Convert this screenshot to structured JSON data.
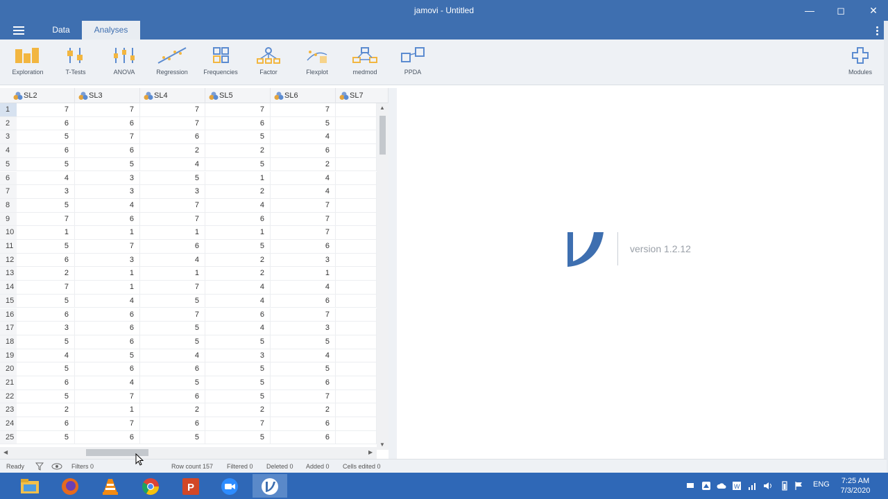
{
  "window": {
    "title": "jamovi - Untitled"
  },
  "tabs": [
    {
      "label": "Data"
    },
    {
      "label": "Analyses"
    }
  ],
  "ribbon": [
    {
      "label": "Exploration",
      "icon": "exploration-icon"
    },
    {
      "label": "T-Tests",
      "icon": "ttests-icon"
    },
    {
      "label": "ANOVA",
      "icon": "anova-icon"
    },
    {
      "label": "Regression",
      "icon": "regression-icon"
    },
    {
      "label": "Frequencies",
      "icon": "frequencies-icon"
    },
    {
      "label": "Factor",
      "icon": "factor-icon"
    },
    {
      "label": "Flexplot",
      "icon": "flexplot-icon"
    },
    {
      "label": "medmod",
      "icon": "medmod-icon"
    },
    {
      "label": "PPDA",
      "icon": "ppda-icon"
    },
    {
      "label": "Modules",
      "icon": "modules-plus-icon"
    }
  ],
  "grid": {
    "columns": [
      "SL2",
      "SL3",
      "SL4",
      "SL5",
      "SL6",
      "SL7"
    ],
    "rows": [
      {
        "n": "1",
        "v": [
          "7",
          "7",
          "7",
          "7",
          "7",
          ""
        ]
      },
      {
        "n": "2",
        "v": [
          "6",
          "6",
          "7",
          "6",
          "5",
          ""
        ]
      },
      {
        "n": "3",
        "v": [
          "5",
          "7",
          "6",
          "5",
          "4",
          ""
        ]
      },
      {
        "n": "4",
        "v": [
          "6",
          "6",
          "2",
          "2",
          "6",
          ""
        ]
      },
      {
        "n": "5",
        "v": [
          "5",
          "5",
          "4",
          "5",
          "2",
          ""
        ]
      },
      {
        "n": "6",
        "v": [
          "4",
          "3",
          "5",
          "1",
          "4",
          ""
        ]
      },
      {
        "n": "7",
        "v": [
          "3",
          "3",
          "3",
          "2",
          "4",
          ""
        ]
      },
      {
        "n": "8",
        "v": [
          "5",
          "4",
          "7",
          "4",
          "7",
          ""
        ]
      },
      {
        "n": "9",
        "v": [
          "7",
          "6",
          "7",
          "6",
          "7",
          ""
        ]
      },
      {
        "n": "10",
        "v": [
          "1",
          "1",
          "1",
          "1",
          "7",
          ""
        ]
      },
      {
        "n": "11",
        "v": [
          "5",
          "7",
          "6",
          "5",
          "6",
          ""
        ]
      },
      {
        "n": "12",
        "v": [
          "6",
          "3",
          "4",
          "2",
          "3",
          ""
        ]
      },
      {
        "n": "13",
        "v": [
          "2",
          "1",
          "1",
          "2",
          "1",
          ""
        ]
      },
      {
        "n": "14",
        "v": [
          "7",
          "1",
          "7",
          "4",
          "4",
          ""
        ]
      },
      {
        "n": "15",
        "v": [
          "5",
          "4",
          "5",
          "4",
          "6",
          ""
        ]
      },
      {
        "n": "16",
        "v": [
          "6",
          "6",
          "7",
          "6",
          "7",
          ""
        ]
      },
      {
        "n": "17",
        "v": [
          "3",
          "6",
          "5",
          "4",
          "3",
          ""
        ]
      },
      {
        "n": "18",
        "v": [
          "5",
          "6",
          "5",
          "5",
          "5",
          ""
        ]
      },
      {
        "n": "19",
        "v": [
          "4",
          "5",
          "4",
          "3",
          "4",
          ""
        ]
      },
      {
        "n": "20",
        "v": [
          "5",
          "6",
          "6",
          "5",
          "5",
          ""
        ]
      },
      {
        "n": "21",
        "v": [
          "6",
          "4",
          "5",
          "5",
          "6",
          ""
        ]
      },
      {
        "n": "22",
        "v": [
          "5",
          "7",
          "6",
          "5",
          "7",
          ""
        ]
      },
      {
        "n": "23",
        "v": [
          "2",
          "1",
          "2",
          "2",
          "2",
          ""
        ]
      },
      {
        "n": "24",
        "v": [
          "6",
          "7",
          "6",
          "7",
          "6",
          ""
        ]
      },
      {
        "n": "25",
        "v": [
          "5",
          "6",
          "5",
          "5",
          "6",
          ""
        ]
      }
    ]
  },
  "results": {
    "version": "version 1.2.12"
  },
  "status": {
    "ready": "Ready",
    "filters": "Filters 0",
    "row_count": "Row count 157",
    "filtered": "Filtered 0",
    "deleted": "Deleted 0",
    "added": "Added 0",
    "cells_edited": "Cells edited 0"
  },
  "taskbar": {
    "lang": "ENG",
    "time": "7:25 AM",
    "date": "7/3/2020"
  },
  "colors": {
    "brand": "#3e6fb0",
    "taskbar": "#2f68b7",
    "ribbon_bg": "#eef1f5"
  }
}
